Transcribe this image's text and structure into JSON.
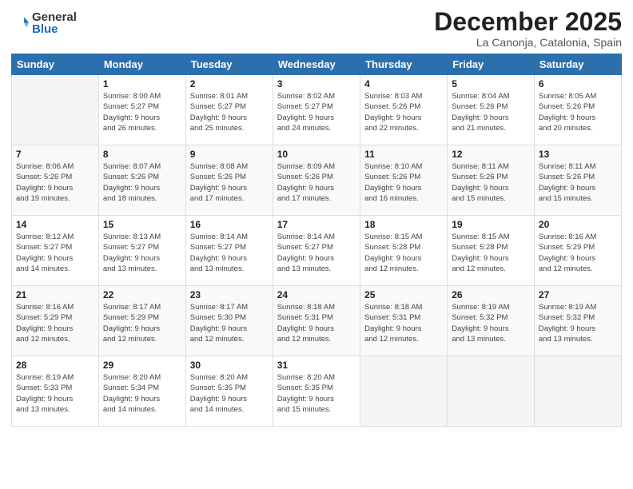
{
  "header": {
    "logo_general": "General",
    "logo_blue": "Blue",
    "month_title": "December 2025",
    "location": "La Canonja, Catalonia, Spain"
  },
  "weekdays": [
    "Sunday",
    "Monday",
    "Tuesday",
    "Wednesday",
    "Thursday",
    "Friday",
    "Saturday"
  ],
  "weeks": [
    [
      {
        "day": "",
        "info": ""
      },
      {
        "day": "1",
        "info": "Sunrise: 8:00 AM\nSunset: 5:27 PM\nDaylight: 9 hours\nand 26 minutes."
      },
      {
        "day": "2",
        "info": "Sunrise: 8:01 AM\nSunset: 5:27 PM\nDaylight: 9 hours\nand 25 minutes."
      },
      {
        "day": "3",
        "info": "Sunrise: 8:02 AM\nSunset: 5:27 PM\nDaylight: 9 hours\nand 24 minutes."
      },
      {
        "day": "4",
        "info": "Sunrise: 8:03 AM\nSunset: 5:26 PM\nDaylight: 9 hours\nand 22 minutes."
      },
      {
        "day": "5",
        "info": "Sunrise: 8:04 AM\nSunset: 5:26 PM\nDaylight: 9 hours\nand 21 minutes."
      },
      {
        "day": "6",
        "info": "Sunrise: 8:05 AM\nSunset: 5:26 PM\nDaylight: 9 hours\nand 20 minutes."
      }
    ],
    [
      {
        "day": "7",
        "info": "Sunrise: 8:06 AM\nSunset: 5:26 PM\nDaylight: 9 hours\nand 19 minutes."
      },
      {
        "day": "8",
        "info": "Sunrise: 8:07 AM\nSunset: 5:26 PM\nDaylight: 9 hours\nand 18 minutes."
      },
      {
        "day": "9",
        "info": "Sunrise: 8:08 AM\nSunset: 5:26 PM\nDaylight: 9 hours\nand 17 minutes."
      },
      {
        "day": "10",
        "info": "Sunrise: 8:09 AM\nSunset: 5:26 PM\nDaylight: 9 hours\nand 17 minutes."
      },
      {
        "day": "11",
        "info": "Sunrise: 8:10 AM\nSunset: 5:26 PM\nDaylight: 9 hours\nand 16 minutes."
      },
      {
        "day": "12",
        "info": "Sunrise: 8:11 AM\nSunset: 5:26 PM\nDaylight: 9 hours\nand 15 minutes."
      },
      {
        "day": "13",
        "info": "Sunrise: 8:11 AM\nSunset: 5:26 PM\nDaylight: 9 hours\nand 15 minutes."
      }
    ],
    [
      {
        "day": "14",
        "info": "Sunrise: 8:12 AM\nSunset: 5:27 PM\nDaylight: 9 hours\nand 14 minutes."
      },
      {
        "day": "15",
        "info": "Sunrise: 8:13 AM\nSunset: 5:27 PM\nDaylight: 9 hours\nand 13 minutes."
      },
      {
        "day": "16",
        "info": "Sunrise: 8:14 AM\nSunset: 5:27 PM\nDaylight: 9 hours\nand 13 minutes."
      },
      {
        "day": "17",
        "info": "Sunrise: 8:14 AM\nSunset: 5:27 PM\nDaylight: 9 hours\nand 13 minutes."
      },
      {
        "day": "18",
        "info": "Sunrise: 8:15 AM\nSunset: 5:28 PM\nDaylight: 9 hours\nand 12 minutes."
      },
      {
        "day": "19",
        "info": "Sunrise: 8:15 AM\nSunset: 5:28 PM\nDaylight: 9 hours\nand 12 minutes."
      },
      {
        "day": "20",
        "info": "Sunrise: 8:16 AM\nSunset: 5:29 PM\nDaylight: 9 hours\nand 12 minutes."
      }
    ],
    [
      {
        "day": "21",
        "info": "Sunrise: 8:16 AM\nSunset: 5:29 PM\nDaylight: 9 hours\nand 12 minutes."
      },
      {
        "day": "22",
        "info": "Sunrise: 8:17 AM\nSunset: 5:29 PM\nDaylight: 9 hours\nand 12 minutes."
      },
      {
        "day": "23",
        "info": "Sunrise: 8:17 AM\nSunset: 5:30 PM\nDaylight: 9 hours\nand 12 minutes."
      },
      {
        "day": "24",
        "info": "Sunrise: 8:18 AM\nSunset: 5:31 PM\nDaylight: 9 hours\nand 12 minutes."
      },
      {
        "day": "25",
        "info": "Sunrise: 8:18 AM\nSunset: 5:31 PM\nDaylight: 9 hours\nand 12 minutes."
      },
      {
        "day": "26",
        "info": "Sunrise: 8:19 AM\nSunset: 5:32 PM\nDaylight: 9 hours\nand 13 minutes."
      },
      {
        "day": "27",
        "info": "Sunrise: 8:19 AM\nSunset: 5:32 PM\nDaylight: 9 hours\nand 13 minutes."
      }
    ],
    [
      {
        "day": "28",
        "info": "Sunrise: 8:19 AM\nSunset: 5:33 PM\nDaylight: 9 hours\nand 13 minutes."
      },
      {
        "day": "29",
        "info": "Sunrise: 8:20 AM\nSunset: 5:34 PM\nDaylight: 9 hours\nand 14 minutes."
      },
      {
        "day": "30",
        "info": "Sunrise: 8:20 AM\nSunset: 5:35 PM\nDaylight: 9 hours\nand 14 minutes."
      },
      {
        "day": "31",
        "info": "Sunrise: 8:20 AM\nSunset: 5:35 PM\nDaylight: 9 hours\nand 15 minutes."
      },
      {
        "day": "",
        "info": ""
      },
      {
        "day": "",
        "info": ""
      },
      {
        "day": "",
        "info": ""
      }
    ]
  ]
}
